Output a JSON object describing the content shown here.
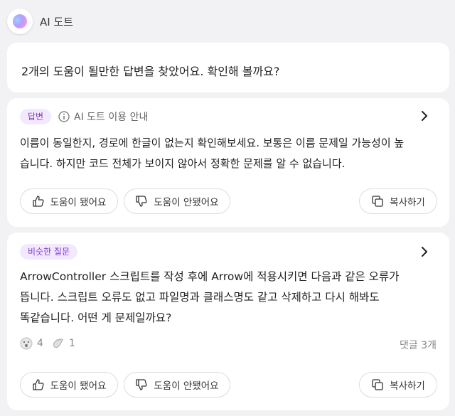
{
  "app": {
    "title": "AI 도트"
  },
  "summary": {
    "text": "2개의 도움이 될만한 답변을 찾았어요. 확인해 볼까요?"
  },
  "answer_card": {
    "badge": "답변",
    "info_label": "AI 도트 이용 안내",
    "line1": "이름이 동일한지, 경로에 한글이 없는지 확인해보세요. 보통은 이름 문제일 가능성이 높",
    "line2": "습니다. 하지만 코드 전체가 보이지 않아서 정확한 문제를 알 수 없습니다.",
    "buttons": {
      "helpful": "도움이 됐어요",
      "not_helpful": "도움이 안됐어요",
      "copy": "복사하기"
    }
  },
  "similar_card": {
    "badge": "비슷한 질문",
    "line1": "ArrowController 스크립트를 작성 후에 Arrow에 적용시키면 다음과 같은 오류가",
    "line2": "뜹니다. 스크립트 오류도 없고 파일명과 클래스명도 같고 삭제하고 다시 해봐도",
    "line3": "똑같습니다. 어떤 게 문제일까요?",
    "reaction1_count": "4",
    "reaction2_count": "1",
    "comments": "댓글 3개",
    "buttons": {
      "helpful": "도움이 됐어요",
      "not_helpful": "도움이 안됐어요",
      "copy": "복사하기"
    }
  },
  "colors": {
    "accent": "#7d3ac9",
    "badge_bg": "#f3e9ff",
    "background": "#f2f2f4"
  }
}
